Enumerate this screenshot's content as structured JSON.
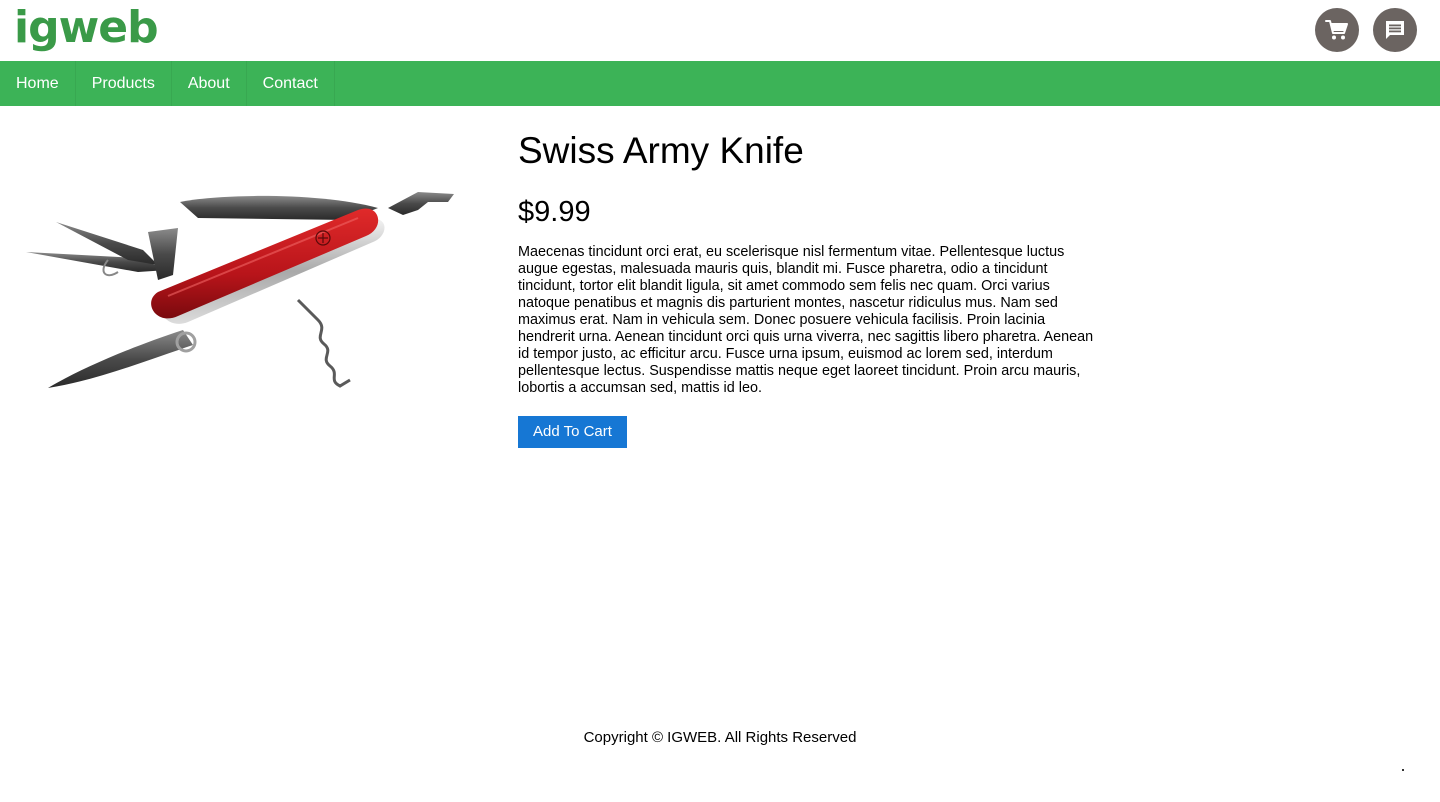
{
  "brand": {
    "logo_text": "igweb",
    "color": "#3a9a48"
  },
  "header": {
    "icons": [
      {
        "name": "cart-icon",
        "label": "cart"
      },
      {
        "name": "chat-icon",
        "label": "chat"
      }
    ],
    "icon_bg": "#6b6461"
  },
  "nav": {
    "background": "#3cb357",
    "items": [
      {
        "label": "Home"
      },
      {
        "label": "Products"
      },
      {
        "label": "About"
      },
      {
        "label": "Contact"
      }
    ]
  },
  "product": {
    "title": "Swiss Army Knife",
    "price": "$9.99",
    "description": "Maecenas tincidunt orci erat, eu scelerisque nisl fermentum vitae. Pellentesque luctus augue egestas, malesuada mauris quis, blandit mi. Fusce pharetra, odio a tincidunt tincidunt, tortor elit blandit ligula, sit amet commodo sem felis nec quam. Orci varius natoque penatibus et magnis dis parturient montes, nascetur ridiculus mus. Nam sed maximus erat. Nam in vehicula sem. Donec posuere vehicula facilisis. Proin lacinia hendrerit urna. Aenean tincidunt orci quis urna viverra, nec sagittis libero pharetra. Aenean id tempor justo, ac efficitur arcu. Fusce urna ipsum, euismod ac lorem sed, interdum pellentesque lectus. Suspendisse mattis neque eget laoreet tincidunt. Proin arcu mauris, lobortis a accumsan sed, mattis id leo.",
    "add_to_cart_label": "Add To Cart",
    "button_color": "#1677d4",
    "image": "swiss-army-knife-image"
  },
  "footer": {
    "copyright": "Copyright © IGWEB. All Rights Reserved"
  }
}
